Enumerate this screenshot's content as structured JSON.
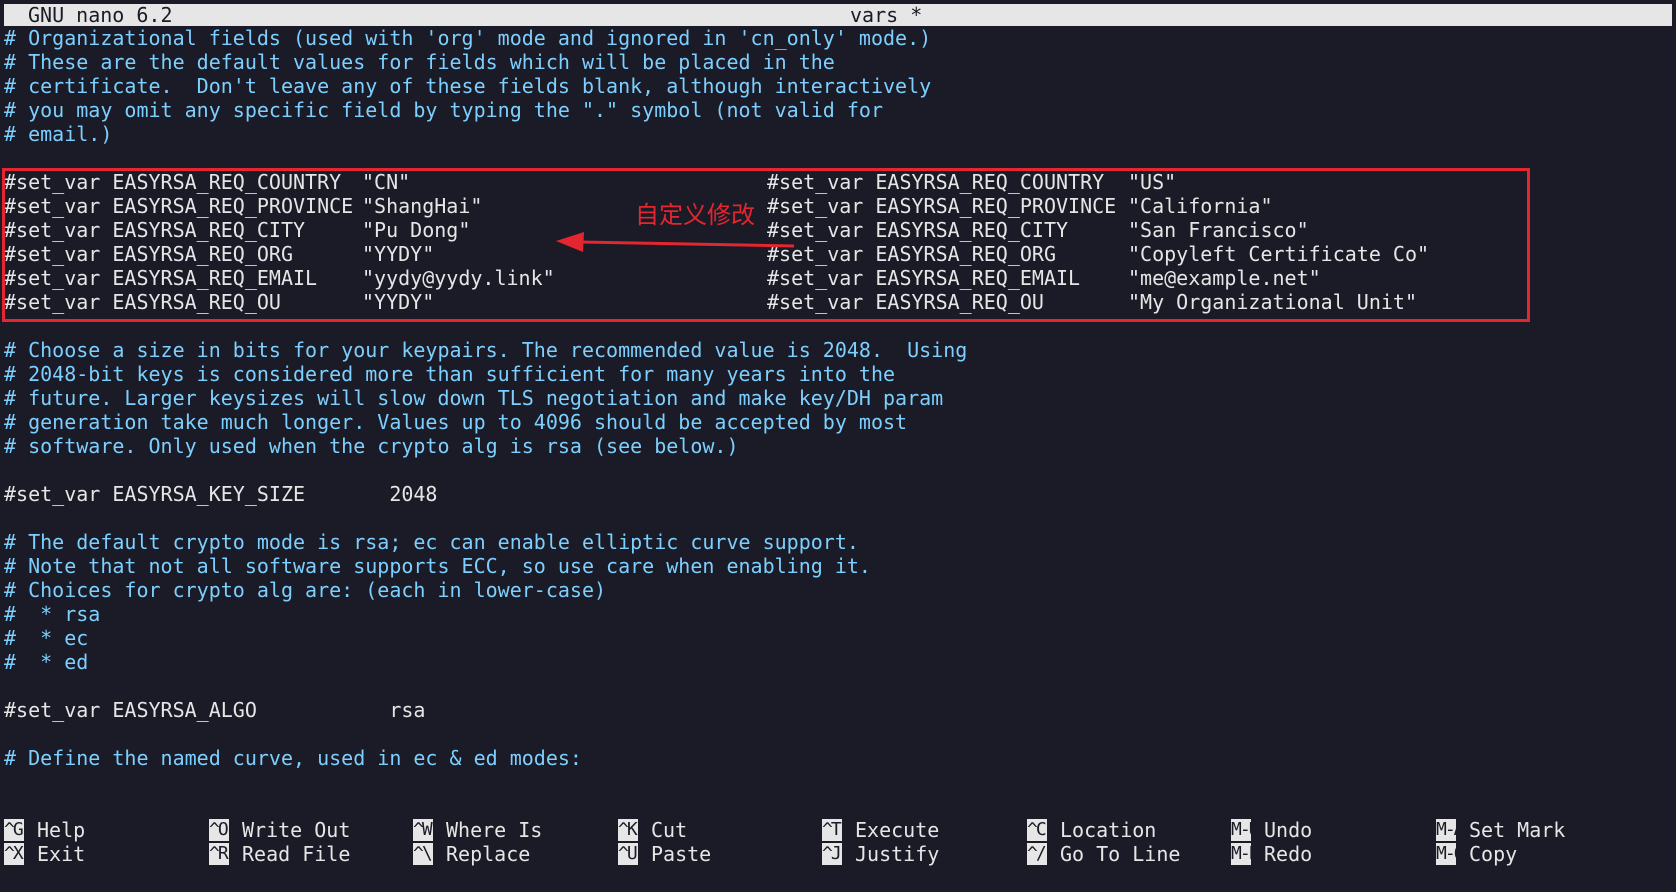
{
  "titlebar": {
    "version": "GNU nano 6.2",
    "filename": "vars *"
  },
  "lines_top": [
    "# Organizational fields (used with 'org' mode and ignored in 'cn_only' mode.)",
    "# These are the default values for fields which will be placed in the",
    "# certificate.  Don't leave any of these fields blank, although interactively",
    "# you may omit any specific field by typing the \".\" symbol (not valid for",
    "# email.)",
    ""
  ],
  "set_vars_left": [
    {
      "name": "#set_var EASYRSA_REQ_COUNTRY",
      "value": "\"CN\""
    },
    {
      "name": "#set_var EASYRSA_REQ_PROVINCE",
      "value": "\"ShangHai\""
    },
    {
      "name": "#set_var EASYRSA_REQ_CITY",
      "value": "\"Pu Dong\""
    },
    {
      "name": "#set_var EASYRSA_REQ_ORG",
      "value": "\"YYDY\""
    },
    {
      "name": "#set_var EASYRSA_REQ_EMAIL",
      "value": "\"yydy@yydy.link\""
    },
    {
      "name": "#set_var EASYRSA_REQ_OU",
      "value": "\"YYDY\""
    }
  ],
  "set_vars_right": [
    {
      "name": "#set_var EASYRSA_REQ_COUNTRY",
      "value": "\"US\""
    },
    {
      "name": "#set_var EASYRSA_REQ_PROVINCE",
      "value": "\"California\""
    },
    {
      "name": "#set_var EASYRSA_REQ_CITY",
      "value": "\"San Francisco\""
    },
    {
      "name": "#set_var EASYRSA_REQ_ORG",
      "value": "\"Copyleft Certificate Co\""
    },
    {
      "name": "#set_var EASYRSA_REQ_EMAIL",
      "value": "\"me@example.net\""
    },
    {
      "name": "#set_var EASYRSA_REQ_OU",
      "value": "\"My Organizational Unit\""
    }
  ],
  "annotation": {
    "label": "自定义修改",
    "color": "#e3262f"
  },
  "lines_bottom": [
    "",
    "# Choose a size in bits for your keypairs. The recommended value is 2048.  Using",
    "# 2048-bit keys is considered more than sufficient for many years into the",
    "# future. Larger keysizes will slow down TLS negotiation and make key/DH param",
    "# generation take much longer. Values up to 4096 should be accepted by most",
    "# software. Only used when the crypto alg is rsa (see below.)",
    "",
    "#set_var EASYRSA_KEY_SIZE       2048",
    "",
    "# The default crypto mode is rsa; ec can enable elliptic curve support.",
    "# Note that not all software supports ECC, so use care when enabling it.",
    "# Choices for crypto alg are: (each in lower-case)",
    "#  * rsa",
    "#  * ec",
    "#  * ed",
    "",
    "#set_var EASYRSA_ALGO           rsa",
    "",
    "# Define the named curve, used in ec & ed modes:"
  ],
  "shortcuts": [
    {
      "key": "^G",
      "label": "Help"
    },
    {
      "key": "^O",
      "label": "Write Out"
    },
    {
      "key": "^W",
      "label": "Where Is"
    },
    {
      "key": "^K",
      "label": "Cut"
    },
    {
      "key": "^T",
      "label": "Execute"
    },
    {
      "key": "^C",
      "label": "Location"
    },
    {
      "key": "M-U",
      "label": "Undo"
    },
    {
      "key": "M-A",
      "label": "Set Mark"
    },
    {
      "key": "^X",
      "label": "Exit"
    },
    {
      "key": "^R",
      "label": "Read File"
    },
    {
      "key": "^\\",
      "label": "Replace"
    },
    {
      "key": "^U",
      "label": "Paste"
    },
    {
      "key": "^J",
      "label": "Justify"
    },
    {
      "key": "^/",
      "label": "Go To Line"
    },
    {
      "key": "M-E",
      "label": "Redo"
    },
    {
      "key": "M-6",
      "label": "Copy"
    }
  ],
  "colors": {
    "comment": "#7dcfff",
    "text": "#e6e6e6",
    "background": "#1a1b26",
    "highlight": "#e3262f"
  }
}
